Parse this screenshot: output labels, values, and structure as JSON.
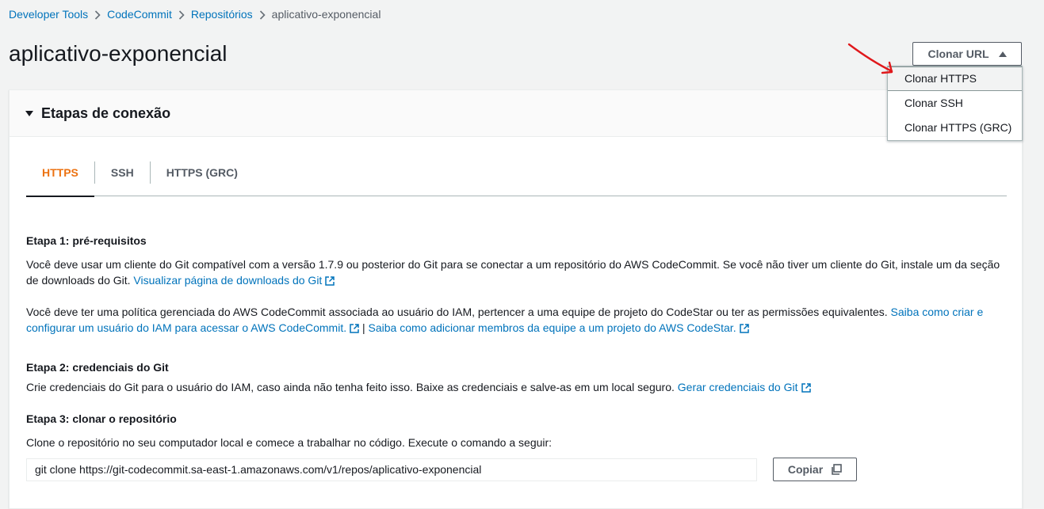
{
  "breadcrumb": {
    "items": [
      "Developer Tools",
      "CodeCommit",
      "Repositórios"
    ],
    "current": "aplicativo-exponencial"
  },
  "page": {
    "title": "aplicativo-exponencial"
  },
  "clone_button": {
    "label": "Clonar URL",
    "icon": "caret-up-icon"
  },
  "clone_menu": {
    "items": [
      "Clonar HTTPS",
      "Clonar SSH",
      "Clonar HTTPS (GRC)"
    ],
    "hovered": "Clonar HTTPS"
  },
  "panel": {
    "title": "Etapas de conexão",
    "tabs": [
      "HTTPS",
      "SSH",
      "HTTPS (GRC)"
    ],
    "active_tab": "HTTPS"
  },
  "step1": {
    "title": "Etapa 1: pré-requisitos",
    "p1_text": "Você deve usar um cliente do Git compatível com a versão 1.7.9 ou posterior do Git para se conectar a um repositório do AWS CodeCommit. Se você não tiver um cliente do Git, instale um da seção de downloads do Git.",
    "p1_link": "Visualizar página de downloads do Git",
    "p2_text": "Você deve ter uma política gerenciada do AWS CodeCommit associada ao usuário do IAM, pertencer a uma equipe de projeto do CodeStar ou ter as permissões equivalentes.",
    "p2_link1": "Saiba como criar e configurar um usuário do IAM para acessar o AWS CodeCommit.",
    "p2_separator": "|",
    "p2_link2": "Saiba como adicionar membros da equipe a um projeto do AWS CodeStar."
  },
  "step2": {
    "title": "Etapa 2: credenciais do Git",
    "text": "Crie credenciais do Git para o usuário do IAM, caso ainda não tenha feito isso. Baixe as credenciais e salve-as em um local seguro.",
    "link": "Gerar credenciais do Git"
  },
  "step3": {
    "title": "Etapa 3: clonar o repositório",
    "text": "Clone o repositório no seu computador local e comece a trabalhar no código. Execute o comando a seguir:",
    "command": "git clone https://git-codecommit.sa-east-1.amazonaws.com/v1/repos/aplicativo-exponencial",
    "copy_label": "Copiar"
  },
  "colors": {
    "link": "#0073bb",
    "active_tab": "#ec7211",
    "annotation_arrow": "#e0181b"
  }
}
